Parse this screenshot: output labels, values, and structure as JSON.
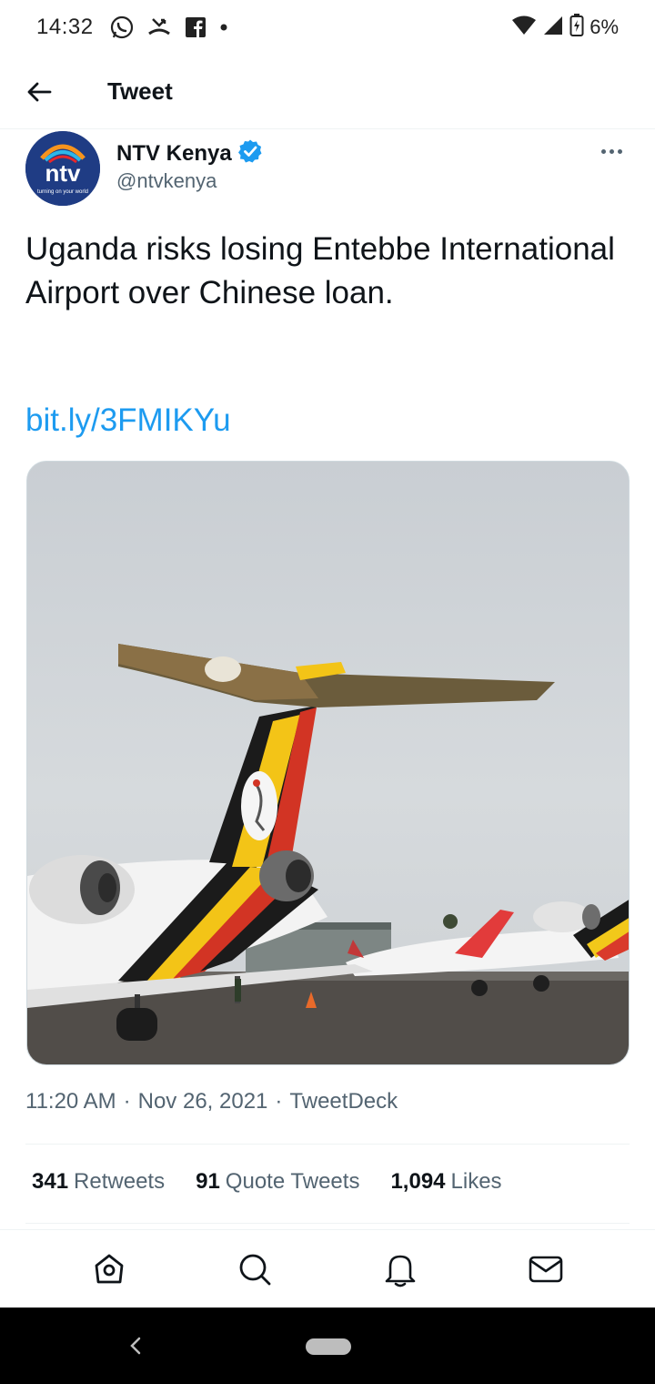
{
  "status_bar": {
    "time": "14:32",
    "battery": "6%",
    "icons": [
      "whatsapp-icon",
      "missed-call-icon",
      "facebook-icon",
      "dot-icon",
      "wifi-icon",
      "signal-icon",
      "battery-icon"
    ]
  },
  "header": {
    "title": "Tweet",
    "back_icon": "arrow-left-icon"
  },
  "tweet": {
    "author_name": "NTV Kenya",
    "author_handle": "@ntvkenya",
    "verified": true,
    "avatar_text": "ntv",
    "avatar_tagline": "turning on your world",
    "text": "Uganda risks losing Entebbe International Airport over Chinese loan.",
    "link": "bit.ly/3FMIKYu",
    "media_alt": "Uganda Airlines aircraft parked at airport",
    "meta": {
      "time": "11:20 AM",
      "separator1": "·",
      "date": "Nov 26, 2021",
      "separator2": "·",
      "source": "TweetDeck"
    },
    "stats": {
      "retweets_count": "341",
      "retweets_label": "Retweets",
      "quotes_count": "91",
      "quotes_label": "Quote Tweets",
      "likes_count": "1,094",
      "likes_label": "Likes"
    }
  },
  "bottom_nav": {
    "items": [
      "home-icon",
      "search-icon",
      "notifications-icon",
      "messages-icon"
    ]
  },
  "colors": {
    "accent": "#1d9bf0",
    "text": "#0f1419",
    "muted": "#536471"
  }
}
